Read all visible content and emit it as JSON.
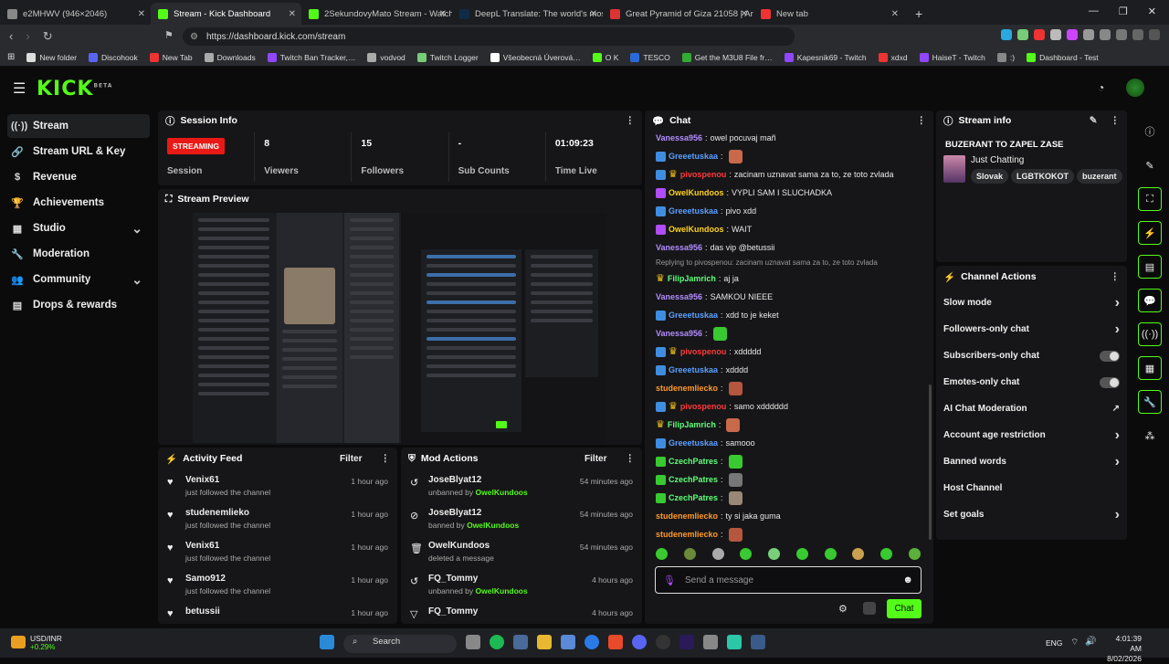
{
  "browser": {
    "tabs": [
      {
        "title": "e2MHWV (946×2046)",
        "color": "#888"
      },
      {
        "title": "Stream - Kick Dashboard",
        "color": "#53fc18"
      },
      {
        "title": "2SekundovyMato Stream - Watch Li…",
        "color": "#53fc18"
      },
      {
        "title": "DeepL Translate: The world's most ac…",
        "color": "#0f2b46"
      },
      {
        "title": "Great Pyramid of Giza 21058 | Archit…",
        "color": "#d33"
      },
      {
        "title": "New tab",
        "color": "#e33"
      }
    ],
    "url": "https://dashboard.kick.com/stream",
    "bookmarks": [
      "New folder",
      "Discohook",
      "New Tab",
      "Downloads",
      "Twitch Ban Tracker,…",
      "vodvod",
      "Twitch Logger",
      "Všeobecná Úverová…",
      "O K",
      "TESCO",
      "Get the M3U8 File fr…",
      "Kapesnik69 - Twitch",
      "xdxd",
      "HaiseT - Twitch",
      ":)",
      "Dashboard - Test"
    ]
  },
  "logo": {
    "text": "KICK",
    "beta": "BETA"
  },
  "sidebar": {
    "items": [
      {
        "label": "Stream",
        "icon": "((·))"
      },
      {
        "label": "Stream URL & Key",
        "icon": "🔗"
      },
      {
        "label": "Revenue",
        "icon": "$"
      },
      {
        "label": "Achievements",
        "icon": "🏆"
      },
      {
        "label": "Studio",
        "icon": "▦"
      },
      {
        "label": "Moderation",
        "icon": "🔧"
      },
      {
        "label": "Community",
        "icon": "👥"
      },
      {
        "label": "Drops & rewards",
        "icon": "▤"
      }
    ]
  },
  "session": {
    "title": "Session Info",
    "status": "STREAMING",
    "cells": [
      {
        "value": "8",
        "label": "Viewers"
      },
      {
        "value": "15",
        "label": "Followers"
      },
      {
        "value": "-",
        "label": "Sub Counts"
      },
      {
        "value": "01:09:23",
        "label": "Time Live"
      }
    ],
    "session_label": "Session"
  },
  "preview": {
    "title": "Stream Preview"
  },
  "activity": {
    "title": "Activity Feed",
    "filter": "Filter",
    "items": [
      {
        "name": "Venix61",
        "sub": "just followed the channel",
        "time": "1 hour ago"
      },
      {
        "name": "studenemlieko",
        "sub": "just followed the channel",
        "time": "1 hour ago"
      },
      {
        "name": "Venix61",
        "sub": "just followed the channel",
        "time": "1 hour ago"
      },
      {
        "name": "Samo912",
        "sub": "just followed the channel",
        "time": "1 hour ago"
      },
      {
        "name": "betussii",
        "sub": "",
        "time": "1 hour ago"
      }
    ]
  },
  "modactions": {
    "title": "Mod Actions",
    "filter": "Filter",
    "items": [
      {
        "name": "JoseBlyat12",
        "pre": "unbanned by",
        "by": "OwelKundoos",
        "time": "54 minutes ago",
        "icon": "↺"
      },
      {
        "name": "JoseBlyat12",
        "pre": "banned by",
        "by": "OwelKundoos",
        "time": "54 minutes ago",
        "icon": "⊘"
      },
      {
        "name": "OwelKundoos",
        "pre": "deleted a message",
        "by": "",
        "time": "54 minutes ago",
        "icon": "🗑"
      },
      {
        "name": "FQ_Tommy",
        "pre": "unbanned by",
        "by": "OwelKundoos",
        "time": "4 hours ago",
        "icon": "↺"
      },
      {
        "name": "FQ_Tommy",
        "pre": "",
        "by": "",
        "time": "4 hours ago",
        "icon": "▽"
      }
    ]
  },
  "chat": {
    "title": "Chat",
    "messages": [
      {
        "user": "Vanessa956",
        "color": "#b28cff",
        "text": "owel pocuvaj mañ"
      },
      {
        "user": "Greeetuskaa",
        "color": "#5aa0ff",
        "text": "",
        "badge": "#3f8de0",
        "emote": "#c86a4a"
      },
      {
        "user": "pivospenou",
        "color": "#ff3a3a",
        "text": "zacinam uznavat sama za to, ze toto zvlada",
        "badge": "#3f8de0",
        "crown": true
      },
      {
        "user": "OwelKundoos",
        "color": "#ffd21e",
        "text": "VYPLI SAM I SLUCHADKA",
        "badge": "#b14cff"
      },
      {
        "user": "Greeetuskaa",
        "color": "#5aa0ff",
        "text": "pivo xdd",
        "badge": "#3f8de0"
      },
      {
        "user": "OwelKundoos",
        "color": "#ffd21e",
        "text": "WAIT",
        "badge": "#b14cff"
      },
      {
        "user": "Vanessa956",
        "color": "#b28cff",
        "text": "das vip @betussii"
      },
      {
        "reply": "Replying to pivospenou: zacinam uznavat sama za to, ze toto zvlada"
      },
      {
        "user": "FilipJamrich",
        "color": "#5fff7a",
        "text": "aj ja",
        "crown": true
      },
      {
        "user": "Vanessa956",
        "color": "#b28cff",
        "text": "SAMKOU NIEEE"
      },
      {
        "user": "Greeetuskaa",
        "color": "#5aa0ff",
        "text": "xdd to je keket",
        "badge": "#3f8de0"
      },
      {
        "user": "Vanessa956",
        "color": "#b28cff",
        "text": "",
        "emote": "#39c930"
      },
      {
        "user": "pivospenou",
        "color": "#ff3a3a",
        "text": "xddddd",
        "badge": "#3f8de0",
        "crown": true
      },
      {
        "user": "Greeetuskaa",
        "color": "#5aa0ff",
        "text": "xdddd",
        "badge": "#3f8de0"
      },
      {
        "user": "studenemliecko",
        "color": "#ff9a2a",
        "text": "",
        "emote": "#b5563e"
      },
      {
        "user": "pivospenou",
        "color": "#ff3a3a",
        "text": "samo xdddddd",
        "badge": "#3f8de0",
        "crown": true
      },
      {
        "user": "FilipJamrich",
        "color": "#5fff7a",
        "text": "",
        "crown": true,
        "emote": "#c86a4a"
      },
      {
        "user": "Greeetuskaa",
        "color": "#5aa0ff",
        "text": "samooo",
        "badge": "#3f8de0"
      },
      {
        "user": "CzechPatres",
        "color": "#5fff7a",
        "text": "",
        "badge": "#39c930",
        "emote": "#39c930"
      },
      {
        "user": "CzechPatres",
        "color": "#5fff7a",
        "text": "",
        "badge": "#39c930",
        "emote": "#777"
      },
      {
        "user": "CzechPatres",
        "color": "#5fff7a",
        "text": "",
        "badge": "#39c930",
        "emote": "#998877"
      },
      {
        "user": "studenemliecko",
        "color": "#ff9a2a",
        "text": "ty si jaka guma"
      },
      {
        "user": "studenemliecko",
        "color": "#ff9a2a",
        "text": "",
        "emote": "#b5563e"
      }
    ],
    "placeholder": "Send a message",
    "send_label": "Chat"
  },
  "streaminfo": {
    "title": "Stream info",
    "stream_title": "BUZERANT TO ZAPEL ZASE",
    "category": "Just Chatting",
    "tags": [
      "Slovak",
      "LGBTKOKOT",
      "buzerant"
    ]
  },
  "channelactions": {
    "title": "Channel Actions",
    "items": [
      {
        "label": "Slow mode",
        "kind": "arrow"
      },
      {
        "label": "Followers-only chat",
        "kind": "arrow"
      },
      {
        "label": "Subscribers-only chat",
        "kind": "toggle"
      },
      {
        "label": "Emotes-only chat",
        "kind": "toggle"
      },
      {
        "label": "AI Chat Moderation",
        "kind": "ext"
      },
      {
        "label": "Account age restriction",
        "kind": "arrow"
      },
      {
        "label": "Banned words",
        "kind": "arrow"
      },
      {
        "label": "Host Channel",
        "kind": "none"
      },
      {
        "label": "Set goals",
        "kind": "arrow"
      }
    ]
  },
  "taskbar": {
    "ticker": "USD/INR",
    "change": "+0.29%",
    "search": "Search",
    "lang": "ENG",
    "time": "4:01:39 AM",
    "date": "8/02/2026"
  }
}
